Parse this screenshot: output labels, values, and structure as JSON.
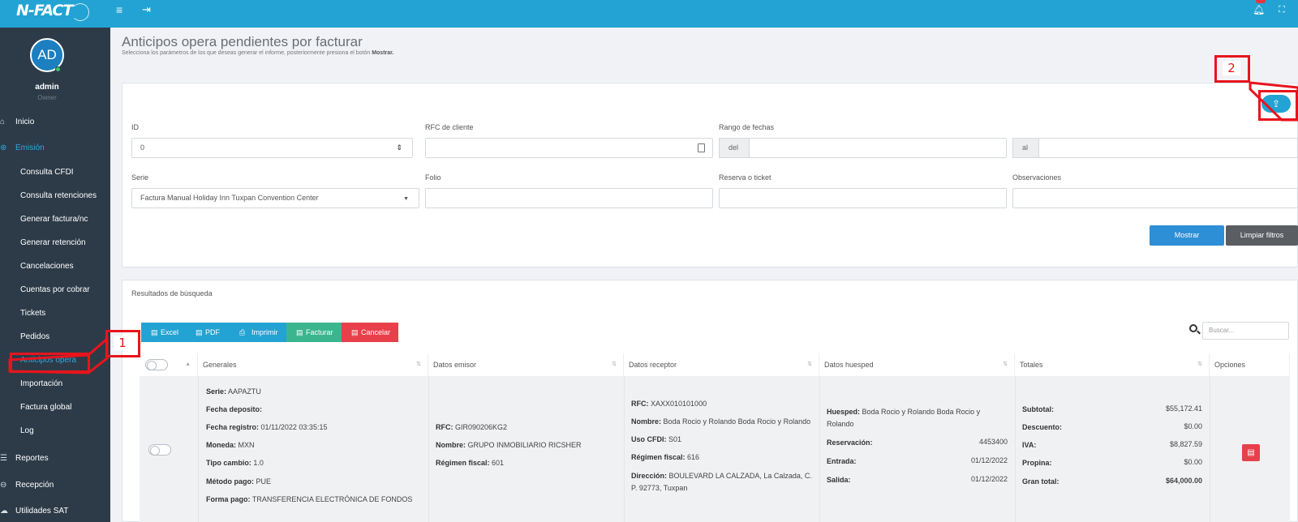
{
  "app": {
    "logo_text": "N-FACT"
  },
  "topbar": {
    "menu_icon": "hamburger-icon",
    "logout_icon": "logout-icon",
    "bell_icon": "bell-icon",
    "fullscreen_icon": "fullscreen-icon"
  },
  "user": {
    "initials": "AD",
    "name": "admin",
    "role": "Owner"
  },
  "sidebar": {
    "items": [
      {
        "label": "Inicio",
        "icon": "home-icon"
      },
      {
        "label": "Emisión",
        "icon": "arrow-circle-icon"
      },
      {
        "label": "Consulta CFDI"
      },
      {
        "label": "Consulta retenciones"
      },
      {
        "label": "Generar factura/nc"
      },
      {
        "label": "Generar retención"
      },
      {
        "label": "Cancelaciones"
      },
      {
        "label": "Cuentas por cobrar"
      },
      {
        "label": "Tickets"
      },
      {
        "label": "Pedidos"
      },
      {
        "label": "Anticipos opera"
      },
      {
        "label": "Importación"
      },
      {
        "label": "Factura global"
      },
      {
        "label": "Log"
      },
      {
        "label": "Reportes",
        "icon": "list-icon"
      },
      {
        "label": "Recepción",
        "icon": "arrow-circle-icon"
      },
      {
        "label": "Utilidades SAT",
        "icon": "cloud-icon"
      }
    ]
  },
  "annotations": {
    "one": "1",
    "two": "2"
  },
  "page": {
    "title": "Anticipos opera pendientes por facturar",
    "subtitle_prefix": "Selecciona los parámetros de los que deseas generar el informe, posteriormente presiona el botón ",
    "subtitle_bold": "Mostrar."
  },
  "filters": {
    "id_label": "ID",
    "id_value": "0",
    "rfc_label": "RFC de cliente",
    "rfc_value": "",
    "rango_label": "Rango de fechas",
    "del_label": "del",
    "al_label": "al",
    "serie_label": "Serie",
    "serie_value": "Factura Manual Holiday Inn Tuxpan Convention Center",
    "folio_label": "Folio",
    "reserva_label": "Reserva o ticket",
    "observaciones_label": "Observaciones",
    "mostrar": "Mostrar",
    "limpiar": "Limpiar filtros"
  },
  "results": {
    "title": "Resultados de búsqueda",
    "toolbar": {
      "excel": "Excel",
      "pdf": "PDF",
      "imprimir": "Imprimir",
      "facturar": "Facturar",
      "cancelar": "Cancelar"
    },
    "search_placeholder": "Buscar...",
    "columns": [
      "Generales",
      "Datos emisor",
      "Datos receptor",
      "Datos huesped",
      "Totales",
      "Opciones"
    ],
    "row": {
      "generales": {
        "serie_k": "Serie:",
        "serie": "AAPAZTU",
        "fecha_dep_k": "Fecha deposito:",
        "fecha_dep": "",
        "fecha_reg_k": "Fecha registro:",
        "fecha_reg": "01/11/2022 03:35:15",
        "moneda_k": "Moneda:",
        "moneda": "MXN",
        "tipo_k": "Tipo cambio:",
        "tipo": "1.0",
        "metodo_k": "Método pago:",
        "metodo": "PUE",
        "forma_k": "Forma pago:",
        "forma": "TRANSFERENCIA ELECTRÓNICA DE FONDOS"
      },
      "emisor": {
        "rfc_k": "RFC:",
        "rfc": "GIR090206KG2",
        "nombre_k": "Nombre:",
        "nombre": "GRUPO INMOBILIARIO RICSHER",
        "regimen_k": "Régimen fiscal:",
        "regimen": "601"
      },
      "receptor": {
        "rfc_k": "RFC:",
        "rfc": "XAXX010101000",
        "nombre_k": "Nombre:",
        "nombre": "Boda Rocio y Rolando Boda Rocio y Rolando",
        "uso_k": "Uso CFDI:",
        "uso": "S01",
        "regimen_k": "Régimen fiscal:",
        "regimen": "616",
        "dir_k": "Dirección:",
        "dir": "BOULEVARD LA CALZADA, La Calzada, C. P. 92773, Tuxpan"
      },
      "huesped": {
        "huesped_k": "Huesped:",
        "huesped": "Boda Rocio y Rolando Boda Rocio y Rolando",
        "reservacion_k": "Reservación:",
        "reservacion": "4453400",
        "entrada_k": "Entrada:",
        "entrada": "01/12/2022",
        "salida_k": "Salida:",
        "salida": "01/12/2022"
      },
      "totales": {
        "subtotal_k": "Subtotal:",
        "subtotal": "$55,172.41",
        "descuento_k": "Descuento:",
        "descuento": "$0.00",
        "iva_k": "IVA:",
        "iva": "$8,827.59",
        "propina_k": "Propina:",
        "propina": "$0.00",
        "gran_k": "Gran total:",
        "gran": "$64,000.00"
      }
    }
  },
  "colors": {
    "topbar": "#22a3d3",
    "sidebar": "#2d3b48",
    "accent": "#2ea8da",
    "annotation": "#e8141c",
    "danger": "#e8404a",
    "success": "#3bb58e"
  }
}
